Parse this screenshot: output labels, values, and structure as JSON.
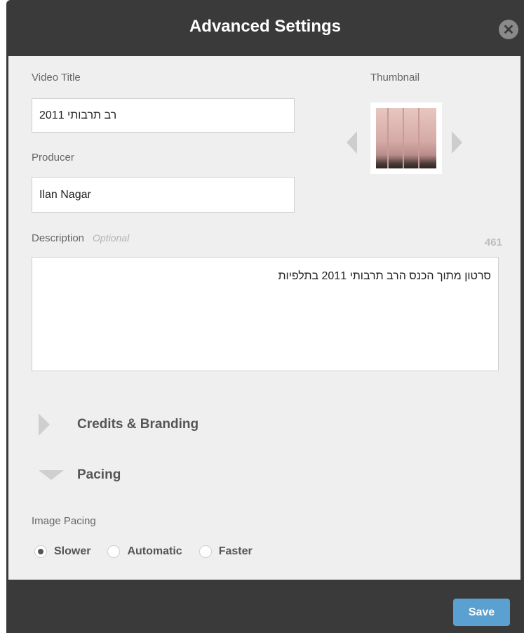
{
  "dialog": {
    "title": "Advanced Settings",
    "close_icon": "close-icon"
  },
  "form": {
    "video_title_label": "Video Title",
    "video_title_value": "רב תרבותי 2011",
    "producer_label": "Producer",
    "producer_value": "Ilan Nagar",
    "thumbnail_label": "Thumbnail",
    "description_label": "Description",
    "description_optional": "Optional",
    "description_counter": "461",
    "description_value": "סרטון מתוך הכנס הרב תרבותי 2011 בתלפיות"
  },
  "sections": {
    "credits_label": "Credits & Branding",
    "pacing_label": "Pacing"
  },
  "pacing": {
    "label": "Image Pacing",
    "options": [
      "Slower",
      "Automatic",
      "Faster"
    ],
    "selected": "Slower"
  },
  "footer": {
    "save_label": "Save"
  },
  "colors": {
    "dialog_bg": "#3a3a3a",
    "panel_bg": "#efefef",
    "save_button": "#5aa0d1"
  }
}
